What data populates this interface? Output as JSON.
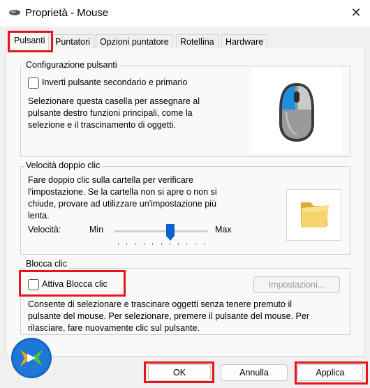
{
  "window": {
    "title": "Proprietà - Mouse",
    "close_glyph": "✕"
  },
  "tabs": [
    {
      "label": "Pulsanti",
      "active": true
    },
    {
      "label": "Puntatori"
    },
    {
      "label": "Opzioni puntatore"
    },
    {
      "label": "Rotellina"
    },
    {
      "label": "Hardware"
    }
  ],
  "config": {
    "group_title": "Configurazione pulsanti",
    "checkbox_label": "Inverti pulsante secondario e primario",
    "checked": false,
    "desc_lines": [
      "Selezionare questa casella per assegnare al",
      "pulsante destro funzioni principali, come la",
      "selezione e il trascinamento di oggetti."
    ],
    "icon": "mouse-icon"
  },
  "speed": {
    "group_title": "Velocità doppio clic",
    "desc_lines": [
      "Fare doppio clic sulla cartella per verificare",
      "l'impostazione. Se la cartella non si apre o non si",
      "chiude, provare ad utilizzare un'impostazione più",
      "lenta."
    ],
    "speed_label": "Velocità:",
    "min_label": "Min",
    "max_label": "Max",
    "slider_value_fraction": 0.6,
    "icon": "folder-icon"
  },
  "clicklock": {
    "group_title": "Blocca clic",
    "checkbox_label": "Attiva Blocca clic",
    "checked": false,
    "settings_button": "Impostazioni...",
    "desc_lines": [
      "Consente di selezionare e trascinare oggetti senza tenere premuto il",
      "pulsante del mouse. Per selezionare, premere il pulsante del mouse. Per",
      "rilasciare, fare nuovamente clic sul pulsante."
    ]
  },
  "buttons": {
    "ok": "OK",
    "cancel": "Annulla",
    "apply": "Applica"
  },
  "colors": {
    "highlight_red": "#e8141c",
    "mouse_blue": "#1e8ee0",
    "folder_yellow": "#f2c94c"
  }
}
